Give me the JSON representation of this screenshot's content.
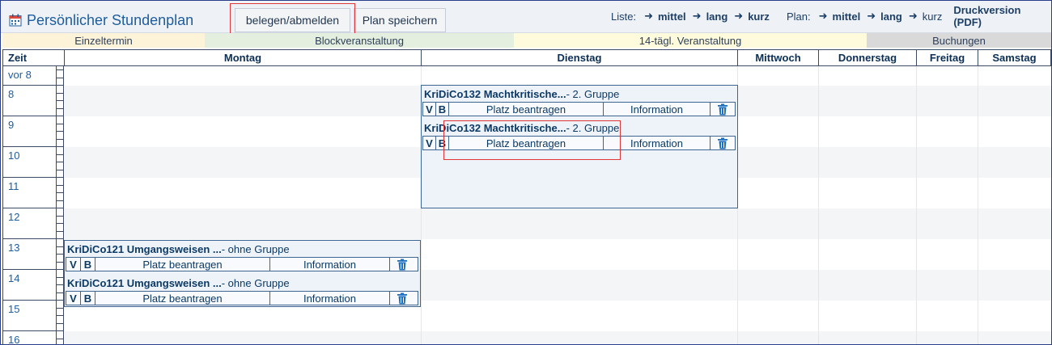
{
  "header": {
    "title": "Persönlicher Stundenplan",
    "btn_belegen": "belegen/abmelden",
    "btn_speichern": "Plan speichern",
    "liste_label": "Liste:",
    "liste_links": [
      "mittel",
      "lang",
      "kurz"
    ],
    "plan_label": "Plan:",
    "plan_links": [
      "mittel",
      "lang",
      "kurz"
    ],
    "print": "Druckversion (PDF)"
  },
  "legend": [
    "Einzeltermin",
    "Blockveranstaltung",
    "14-tägl. Veranstaltung",
    "Buchungen"
  ],
  "columns": {
    "zeit": "Zeit",
    "days": [
      "Montag",
      "Dienstag",
      "Mittwoch",
      "Donnerstag",
      "Freitag",
      "Samstag"
    ]
  },
  "times": [
    "vor 8",
    "8",
    "9",
    "10",
    "11",
    "12",
    "13",
    "14",
    "15",
    "16"
  ],
  "events": {
    "dienstag": [
      {
        "title": "KriDiCo132 Machtkritische...",
        "group": " - 2. Gruppe",
        "v": "V",
        "b": "B",
        "platz": "Platz beantragen",
        "info": "Information"
      },
      {
        "title": "KriDiCo132 Machtkritische...",
        "group": " - 2. Gruppe",
        "v": "V",
        "b": "B",
        "platz": "Platz beantragen",
        "info": "Information"
      }
    ],
    "montag": [
      {
        "title": "KriDiCo121 Umgangsweisen ...",
        "group": " - ohne Gruppe",
        "v": "V",
        "b": "B",
        "platz": "Platz beantragen",
        "info": "Information"
      },
      {
        "title": "KriDiCo121 Umgangsweisen ...",
        "group": " - ohne Gruppe",
        "v": "V",
        "b": "B",
        "platz": "Platz beantragen",
        "info": "Information"
      }
    ]
  },
  "colors": {
    "accent": "#1d5d9e",
    "event_bg": "#eef3fa",
    "highlight": "#e03838"
  }
}
